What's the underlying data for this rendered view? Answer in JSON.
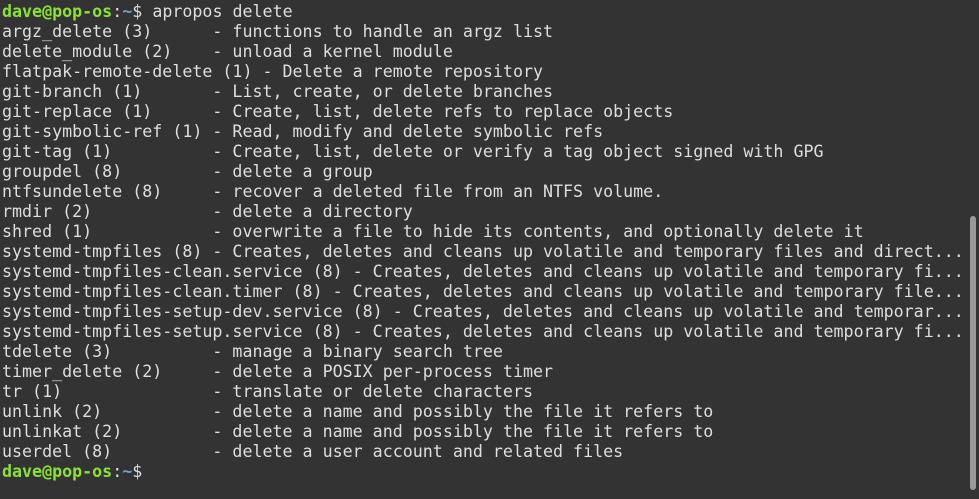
{
  "prompt": {
    "user_host": "dave@pop-os",
    "separator": ":",
    "path": "~",
    "symbol": "$"
  },
  "command": "apropos delete",
  "results": [
    "argz_delete (3)      - functions to handle an argz list",
    "delete_module (2)    - unload a kernel module",
    "flatpak-remote-delete (1) - Delete a remote repository",
    "git-branch (1)       - List, create, or delete branches",
    "git-replace (1)      - Create, list, delete refs to replace objects",
    "git-symbolic-ref (1) - Read, modify and delete symbolic refs",
    "git-tag (1)          - Create, list, delete or verify a tag object signed with GPG",
    "groupdel (8)         - delete a group",
    "ntfsundelete (8)     - recover a deleted file from an NTFS volume.",
    "rmdir (2)            - delete a directory",
    "shred (1)            - overwrite a file to hide its contents, and optionally delete it",
    "systemd-tmpfiles (8) - Creates, deletes and cleans up volatile and temporary files and direct...",
    "systemd-tmpfiles-clean.service (8) - Creates, deletes and cleans up volatile and temporary fi...",
    "systemd-tmpfiles-clean.timer (8) - Creates, deletes and cleans up volatile and temporary file...",
    "systemd-tmpfiles-setup-dev.service (8) - Creates, deletes and cleans up volatile and temporar...",
    "systemd-tmpfiles-setup.service (8) - Creates, deletes and cleans up volatile and temporary fi...",
    "tdelete (3)          - manage a binary search tree",
    "timer_delete (2)     - delete a POSIX per-process timer",
    "tr (1)               - translate or delete characters",
    "unlink (2)           - delete a name and possibly the file it refers to",
    "unlinkat (2)         - delete a name and possibly the file it refers to",
    "userdel (8)          - delete a user account and related files"
  ],
  "colors": {
    "background": "#333333",
    "text": "#dedede",
    "user_host": "#8ae234",
    "path": "#729fcf",
    "scroll_thumb": "#9a9a9a"
  }
}
